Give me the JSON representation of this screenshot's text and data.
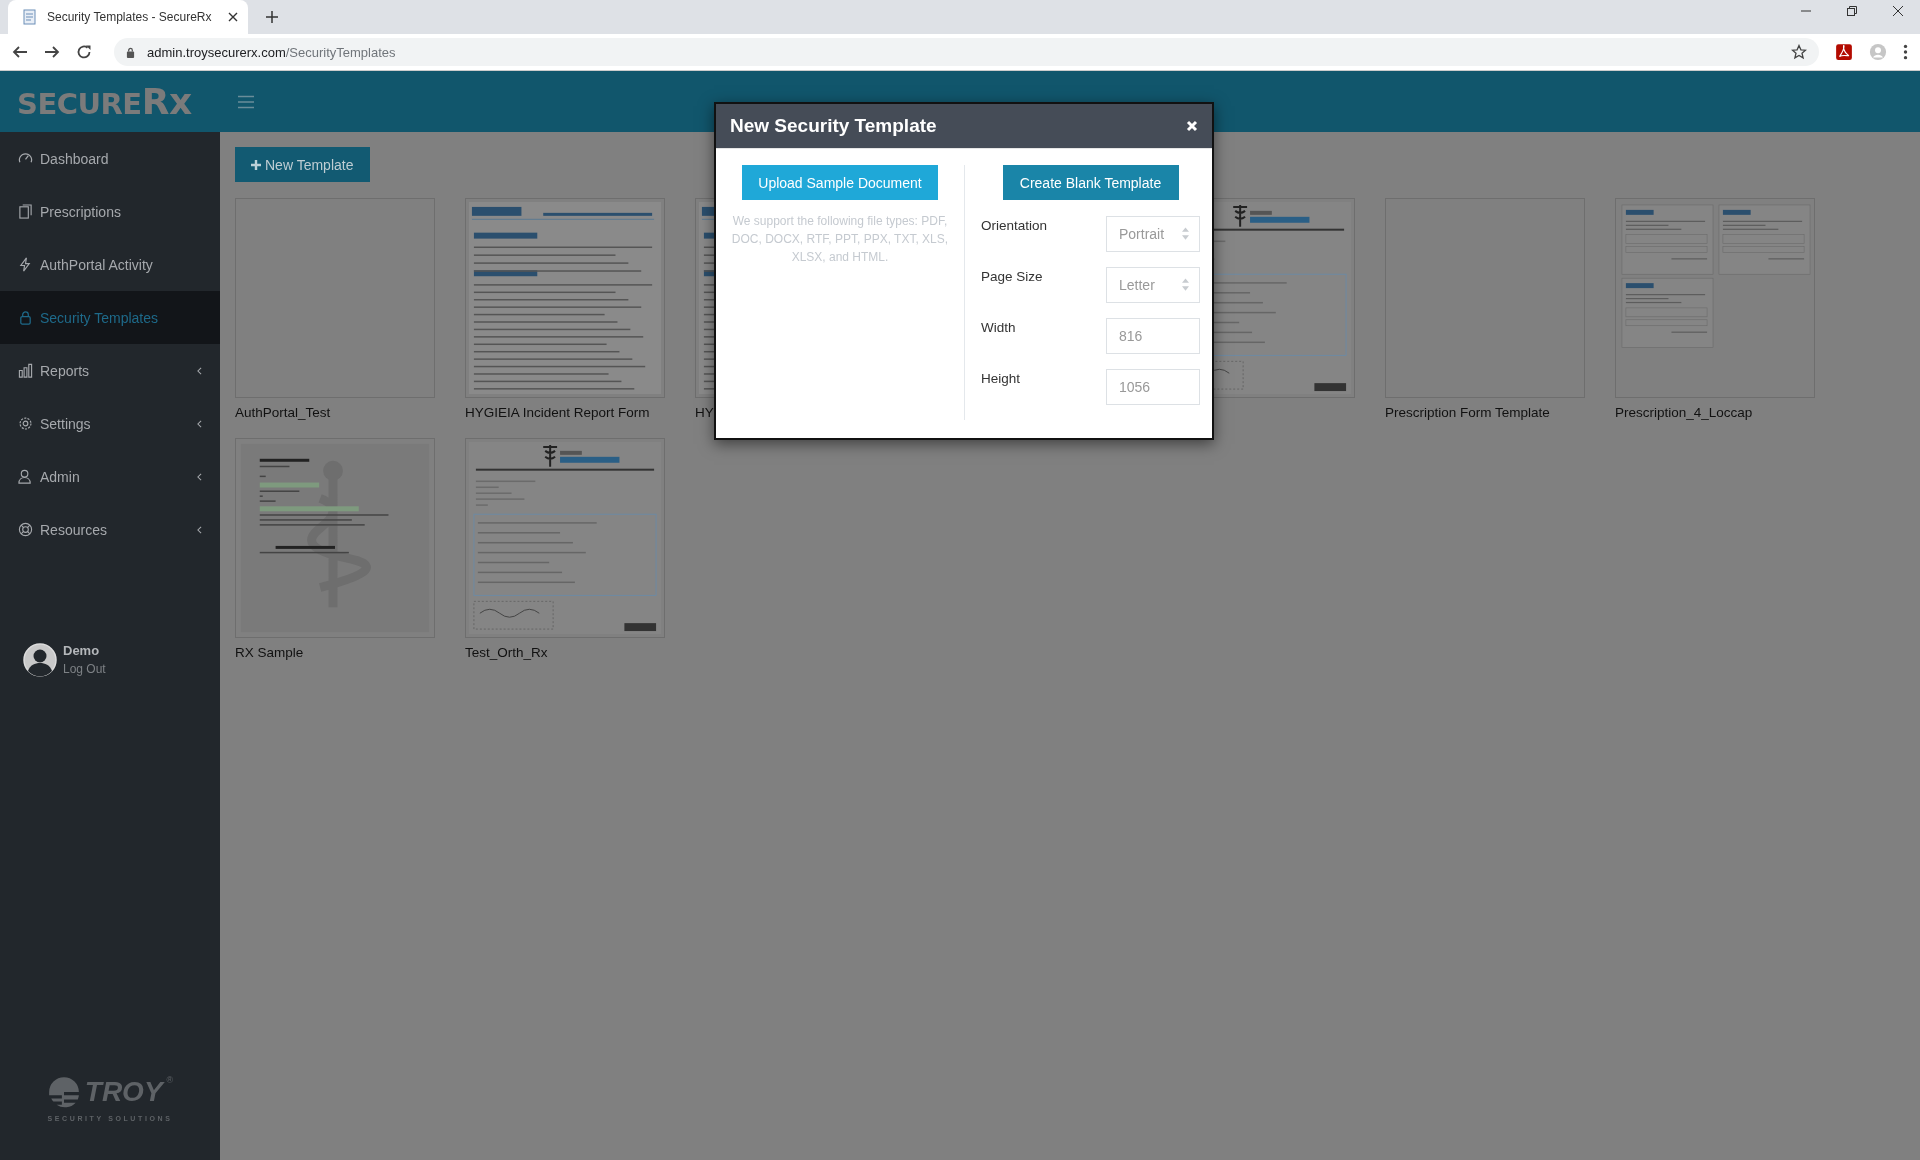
{
  "browser": {
    "tab_title": "Security Templates - SecureRx",
    "url_host": "admin.troysecurerx.com",
    "url_path": "/SecurityTemplates"
  },
  "brand": {
    "name": "SECURE",
    "suffix": "Rx"
  },
  "sidebar": {
    "items": [
      {
        "label": "Dashboard",
        "submenu": false,
        "selected": false
      },
      {
        "label": "Prescriptions",
        "submenu": false,
        "selected": false
      },
      {
        "label": "AuthPortal Activity",
        "submenu": false,
        "selected": false
      },
      {
        "label": "Security Templates",
        "submenu": false,
        "selected": true
      },
      {
        "label": "Reports",
        "submenu": true,
        "selected": false
      },
      {
        "label": "Settings",
        "submenu": true,
        "selected": false
      },
      {
        "label": "Admin",
        "submenu": true,
        "selected": false
      },
      {
        "label": "Resources",
        "submenu": true,
        "selected": false
      }
    ],
    "user": {
      "name": "Demo",
      "action": "Log Out"
    },
    "footer_logo": {
      "name": "TROY",
      "mark": "®",
      "tagline": "SECURITY SOLUTIONS"
    }
  },
  "new_template_button": "New Template",
  "templates": [
    {
      "kind": "blank",
      "label": "AuthPortal_Test"
    },
    {
      "kind": "incident",
      "label": "HYGIEIA Incident Report Form"
    },
    {
      "kind": "incident",
      "label": "HY"
    },
    {
      "kind": "covered"
    },
    {
      "kind": "orthopedics"
    },
    {
      "kind": "blank",
      "label": "Prescription Form Template"
    },
    {
      "kind": "loccap",
      "label": "Prescription_4_Loccap"
    },
    {
      "kind": "rx",
      "label": "RX Sample"
    },
    {
      "kind": "orthopedics",
      "label": "Test_Orth_Rx"
    }
  ],
  "modal": {
    "title": "New Security Template",
    "upload_button": "Upload Sample Document",
    "upload_note": "We support the following file types: PDF, DOC, DOCX, RTF, PPT, PPX, TXT, XLS, XLSX, and HTML.",
    "create_button": "Create Blank Template",
    "fields": [
      {
        "kind": "select",
        "label": "Orientation",
        "value": "Portrait"
      },
      {
        "kind": "select",
        "label": "Page Size",
        "value": "Letter"
      },
      {
        "kind": "input",
        "label": "Width",
        "value": "816"
      },
      {
        "kind": "input",
        "label": "Height",
        "value": "1056"
      }
    ]
  }
}
